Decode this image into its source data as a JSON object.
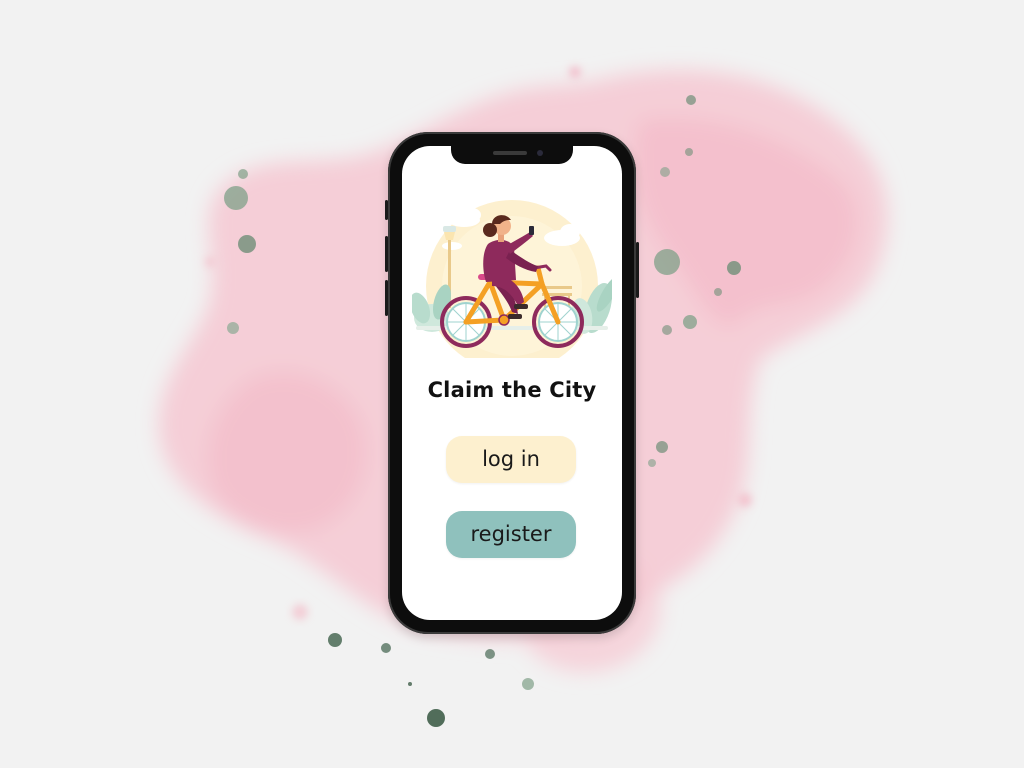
{
  "app": {
    "title": "Claim the City"
  },
  "buttons": {
    "login_label": "log in",
    "register_label": "register"
  },
  "illustration": {
    "name": "woman-riding-bicycle-illustration"
  },
  "colors": {
    "background": "#f2f2f2",
    "splash_pink": "#f6c8d2",
    "splash_green": "#6f8f78",
    "login_button": "#fdf0cf",
    "register_button": "#8fc1bd",
    "bike_frame": "#f4a024",
    "rider_outfit": "#8e2a5c",
    "phone_body": "#0d0d0d"
  }
}
